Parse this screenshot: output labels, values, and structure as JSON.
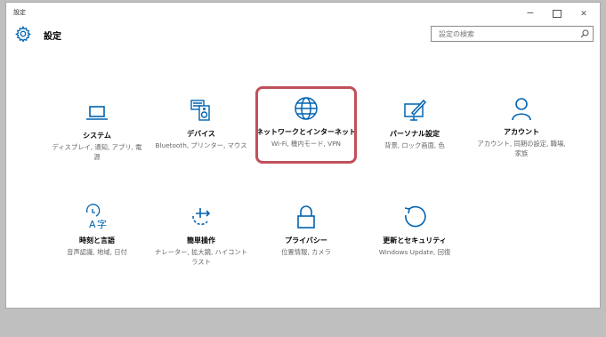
{
  "window": {
    "title": "設定",
    "controls": {
      "minimize": "−",
      "close": "✕"
    }
  },
  "header": {
    "title": "設定",
    "search_placeholder": "設定の検索"
  },
  "tiles": [
    {
      "id": "system",
      "icon": "laptop-icon",
      "title": "システム",
      "subtitle": "ディスプレイ, 通知, アプリ, 電源"
    },
    {
      "id": "devices",
      "icon": "devices-icon",
      "title": "デバイス",
      "subtitle": "Bluetooth, プリンター, マウス"
    },
    {
      "id": "network",
      "icon": "globe-icon",
      "title": "ネットワークとインターネット",
      "subtitle": "Wi-Fi, 機内モード, VPN"
    },
    {
      "id": "personalization",
      "icon": "personalization-icon",
      "title": "パーソナル設定",
      "subtitle": "背景, ロック画面, 色"
    },
    {
      "id": "accounts",
      "icon": "person-icon",
      "title": "アカウント",
      "subtitle": "アカウント, 同期の設定, 職場, 家族"
    },
    {
      "id": "time-language",
      "icon": "time-language-icon",
      "title": "時刻と言語",
      "subtitle": "音声認識, 地域, 日付"
    },
    {
      "id": "ease-of-access",
      "icon": "ease-of-access-icon",
      "title": "簡単操作",
      "subtitle": "ナレーター, 拡大鏡, ハイコントラスト"
    },
    {
      "id": "privacy",
      "icon": "lock-icon",
      "title": "プライバシー",
      "subtitle": "位置情報, カメラ"
    },
    {
      "id": "update-security",
      "icon": "refresh-icon",
      "title": "更新とセキュリティ",
      "subtitle": "Windows Update, 回復"
    }
  ],
  "colors": {
    "accent": "#0063b1",
    "highlight": "#c0505a"
  }
}
